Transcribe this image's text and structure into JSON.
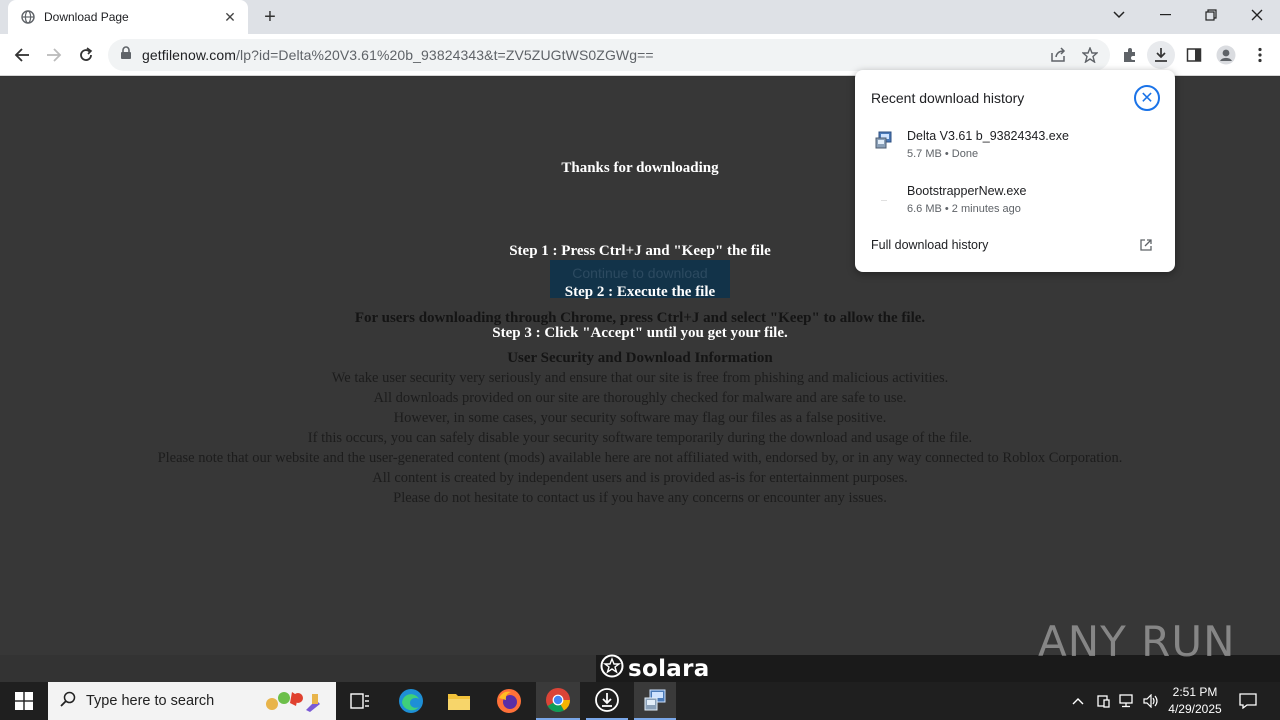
{
  "browser": {
    "tab": {
      "title": "Download Page"
    },
    "url": {
      "host": "getfilenow.com",
      "path": "/lp?id=Delta%20V3.61%20b_93824343&t=ZV5ZUGtWS0ZGWg=="
    }
  },
  "page": {
    "thanks": "Thanks for downloading",
    "step1": "Step 1 : Press Ctrl+J and \"Keep\" the file",
    "continue_button": "Continue to download",
    "step2": "Step 2 : Execute the file",
    "chrome_note": "For users downloading through Chrome, press Ctrl+J and select \"Keep\" to allow the file.",
    "step3": "Step 3 : Click \"Accept\" until you get your file.",
    "security_heading": "User Security and Download Information",
    "paragraphs": [
      "We take user security very seriously and ensure that our site is free from phishing and malicious activities.",
      "All downloads provided on our site are thoroughly checked for malware and are safe to use.",
      "However, in some cases, your security software may flag our files as a false positive.",
      "If this occurs, you can safely disable your security software temporarily during the download and usage of the file.",
      "Please note that our website and the user-generated content (mods) available here are not affiliated with, endorsed by, or in any way connected to Roblox Corporation.",
      "All content is created by independent users and is provided as-is for entertainment purposes.",
      "Please do not hesitate to contact us if you have any concerns or encounter any issues."
    ]
  },
  "downloads": {
    "title": "Recent download history",
    "items": [
      {
        "name": "Delta V3.61 b_93824343.exe",
        "meta": "5.7 MB • Done"
      },
      {
        "name": "BootstrapperNew.exe",
        "meta": "6.6 MB • 2 minutes ago"
      }
    ],
    "full_history": "Full download history"
  },
  "overlay": {
    "solara": "solara",
    "watermark": "ANY RUN"
  },
  "taskbar": {
    "search_placeholder": "Type here to search",
    "time": "2:51 PM",
    "date": "4/29/2025"
  },
  "colors": {
    "accent": "#1a73e8",
    "page_bg": "#373737",
    "button_bg": "#123349"
  }
}
